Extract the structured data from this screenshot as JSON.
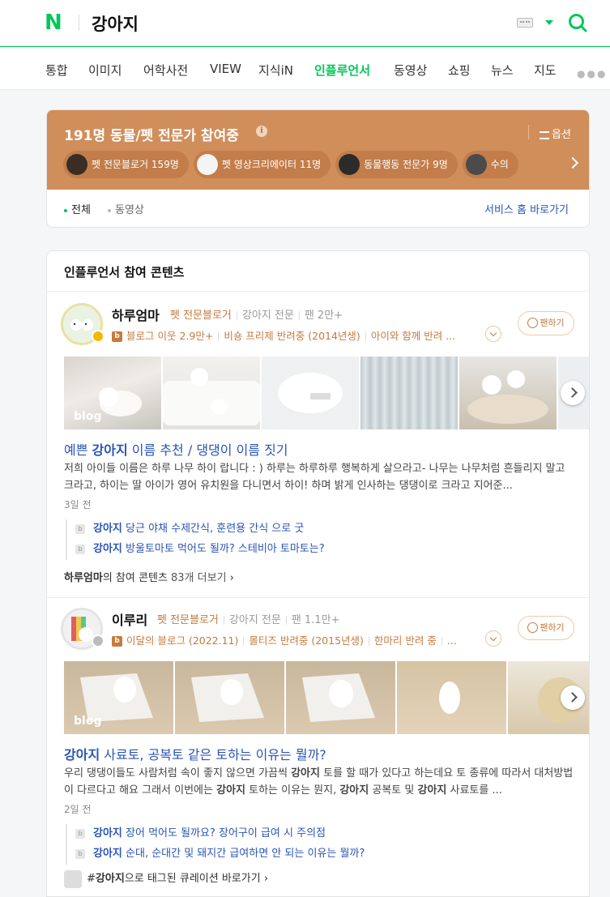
{
  "header": {
    "logo": "N",
    "query": "강아지"
  },
  "nav": {
    "items": [
      "통합",
      "이미지",
      "어학사전",
      "VIEW",
      "지식iN",
      "인플루언서",
      "동영상",
      "쇼핑",
      "뉴스",
      "지도"
    ],
    "active": "인플루언서"
  },
  "influencer_box": {
    "title": "191명 동물/펫 전문가 참여중",
    "info": "i",
    "option": "옵션",
    "chips": [
      {
        "label": "펫 전문블로거",
        "count": "159명"
      },
      {
        "label": "펫 영상크리에이터",
        "count": "11명"
      },
      {
        "label": "동물행동 전문가",
        "count": "9명"
      },
      {
        "label": "수의",
        "count": ""
      }
    ],
    "filters": {
      "all": "전체",
      "video": "동영상"
    },
    "service_link": "서비스 홈 바로가기"
  },
  "content": {
    "title": "인플루언서 참여 콘텐츠",
    "posts": [
      {
        "author": "하루엄마",
        "category": "펫 전문블로거",
        "keyword": "강아지 전문",
        "fans": "팬 2만+",
        "blog": "블로그 이웃 2.9만+",
        "pet": "비숑 프리제 반려중 (2014년생)",
        "extra": "아이와 함께 반려 ...",
        "fan_button": "팬하기",
        "title_prefix": "예쁜 ",
        "title_bold": "강아지",
        "title_suffix": " 이름 추천 / 댕댕이 이름 짓기",
        "desc": "저희 아이들 이름은 하루 나무 하이 랍니다 : ) 하루는 하루하루 행복하게 살으라고- 나무는 나무처럼 흔들리지 말고 크라고, 하이는 딸 아이가 영어 유치원을 다니면서 하이! 하며 밝게 인사하는 댕댕이로 크라고 지어준...",
        "date": "3일 전",
        "related": [
          {
            "bold": "강아지",
            "text": " 당근 야채 수제간식, 훈련용 간식 으로 굿"
          },
          {
            "bold": "강아지",
            "text": " 방울토마토 먹어도 될까? 스테비아 토마토는?"
          }
        ],
        "more_name": "하루엄마",
        "more_text": "의 참여 콘텐츠 ",
        "more_count": "83개 더보기",
        "watermark": "blog"
      },
      {
        "author": "이루리",
        "category": "펫 전문블로거",
        "keyword": "강아지 전문",
        "fans": "팬 1.1만+",
        "blog": "이달의 블로그 (2022.11)",
        "pet": "몰티즈 반려중 (2015년생)",
        "extra": "한마리 반려 중",
        "extra2": "...",
        "fan_button": "팬하기",
        "title_prefix": "",
        "title_bold": "강아지",
        "title_suffix": " 사료토, 공복토 같은 토하는 이유는 뭘까?",
        "desc_parts": [
          "우리 댕댕이들도 사람처럼 속이 좋지 않으면 가끔씩 ",
          "강아지",
          " 토를 할 때가 있다고 하는데요 토 종류에 따라서 대처방법이 다르다고 해요 그래서 이번에는 ",
          "강아지",
          " 토하는 이유는 뭔지, ",
          "강아지",
          " 공복토 및 ",
          "강아지",
          " 사료토를 ..."
        ],
        "date": "2일 전",
        "related": [
          {
            "bold": "강아지",
            "text": " 장어 먹어도 될까요? 장어구이 급여 시 주의점"
          },
          {
            "bold": "강아지",
            "text": " 순대, 순대간 및 돼지간 급여하면 안 되는 이유는 뭘까?"
          }
        ],
        "tag_prefix": "#",
        "tag_bold": "강아지",
        "tag_text": "으로 태그된 큐레이션 바로가기",
        "watermark": "blog"
      }
    ]
  },
  "colors": {
    "accent": "#03c75a",
    "banner": "#d08e5b",
    "link": "#2a55b5",
    "pet_category": "#c57a3e"
  }
}
